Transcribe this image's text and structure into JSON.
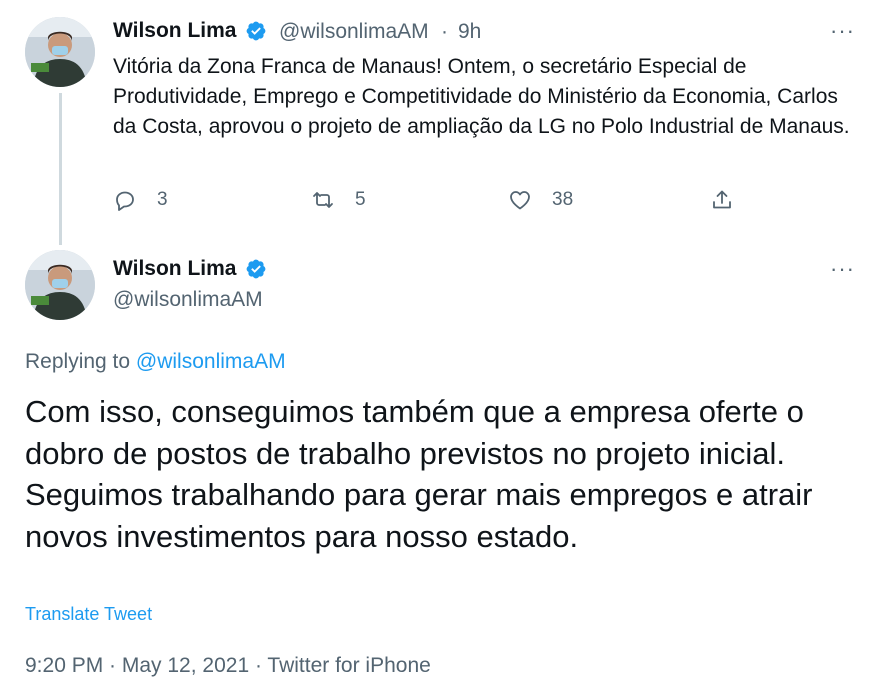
{
  "parent_tweet": {
    "author_name": "Wilson Lima",
    "handle": "@wilsonlimaAM",
    "separator": "·",
    "time": "9h",
    "more_label": "···",
    "text": "Vitória da Zona Franca de Manaus! Ontem, o secretário Especial de Produtividade, Emprego e Competitividade do Ministério da Economia, Carlos da Costa, aprovou o projeto de ampliação da LG no Polo Industrial de Manaus.",
    "reply_count": "3",
    "retweet_count": "5",
    "like_count": "38"
  },
  "main_tweet": {
    "author_name": "Wilson Lima",
    "handle": "@wilsonlimaAM",
    "more_label": "···",
    "replying_prefix": "Replying to",
    "replying_handle": "@wilsonlimaAM",
    "text": "Com isso, conseguimos também que a empresa oferte o dobro de postos de trabalho previstos no projeto inicial. Seguimos trabalhando para gerar mais empregos e atrair novos investimentos para nosso estado.",
    "translate_label": "Translate Tweet",
    "timestamp": "9:20 PM · May 12, 2021 · Twitter for iPhone"
  },
  "colors": {
    "accent": "#1d9bf0",
    "text_primary": "#0f1419",
    "text_secondary": "#536471",
    "thread_line": "#cfd9de"
  },
  "icons": [
    "reply-icon",
    "retweet-icon",
    "like-icon",
    "share-icon",
    "verified-badge-icon"
  ]
}
